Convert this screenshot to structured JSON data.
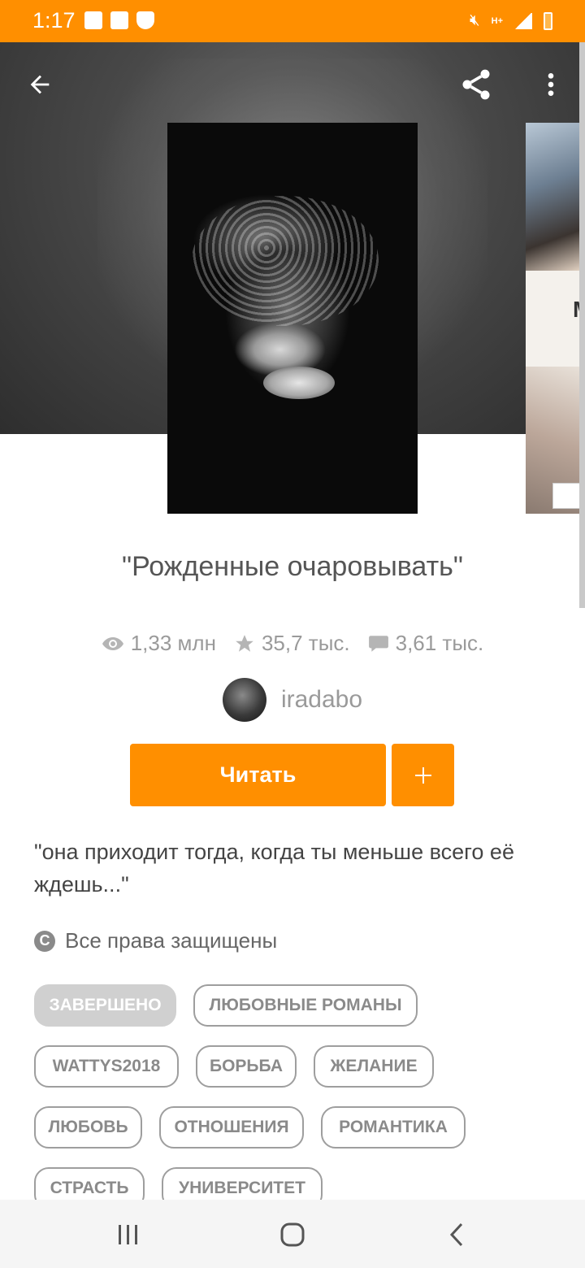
{
  "status_bar": {
    "time": "1:17",
    "network": "H+",
    "bar_color": "#ff8f00"
  },
  "header": {
    "back_icon": "arrow-left-icon",
    "share_icon": "share-icon",
    "menu_icon": "more-vertical-icon"
  },
  "story": {
    "title": "\"Рожденные очаровывать\"",
    "views": "1,33 млн",
    "votes": "35,7 тыс.",
    "comments": "3,61 тыс.",
    "author": "iradabo",
    "description": "\"она приходит тогда, когда ты меньше всего её ждешь...\"",
    "copyright": "Все права защищены",
    "copyright_glyph": "C"
  },
  "actions": {
    "read_label": "Читать",
    "add_label": "+",
    "accent": "#ff8f00"
  },
  "tags": [
    "ЗАВЕРШЕНО",
    "ЛЮБОВНЫЕ РОМАНЫ",
    "WATTYS2018",
    "БОРЬБА",
    "ЖЕЛАНИЕ",
    "ЛЮБОВЬ",
    "ОТНОШЕНИЯ",
    "РОМАНТИКА",
    "СТРАСТЬ",
    "УНИВЕРСИТЕТ"
  ],
  "next_cover": {
    "letter": "M"
  },
  "nav_bar": {
    "recent_icon": "recent-apps-icon",
    "home_icon": "home-icon",
    "back_icon": "back-chevron-icon"
  }
}
